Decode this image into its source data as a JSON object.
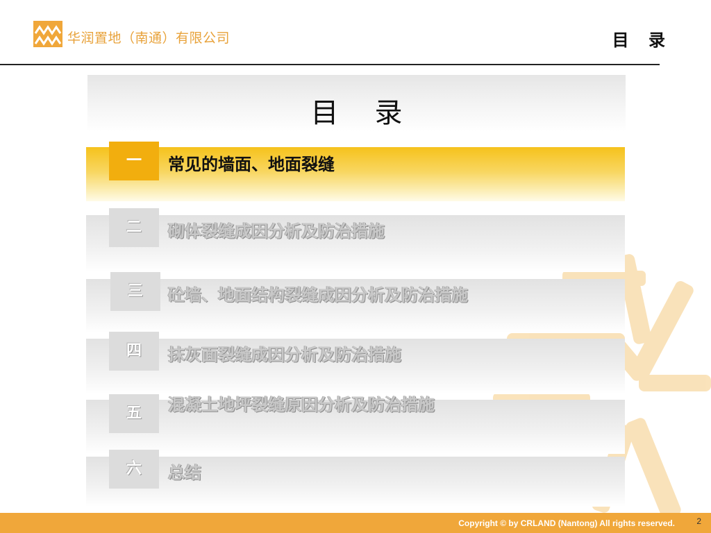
{
  "header": {
    "company_name": "华润置地（南通）有限公司",
    "title": "目 录"
  },
  "panel": {
    "title": "目录"
  },
  "toc": {
    "items": [
      {
        "num": "一",
        "label": "常见的墙面、地面裂缝",
        "active": true
      },
      {
        "num": "二",
        "label": "砌体裂缝成因分析及防治措施",
        "active": false
      },
      {
        "num": "三",
        "label": "砼墙、地面结构裂缝成因分析及防治措施",
        "active": false
      },
      {
        "num": "四",
        "label": "抹灰面裂缝成因分析及防治措施",
        "active": false
      },
      {
        "num": "五",
        "label": "混凝土地坪裂缝原因分析及防治措施",
        "active": false
      },
      {
        "num": "六",
        "label": "总结",
        "active": false
      }
    ]
  },
  "footer": {
    "copyright": "Copyright © by CRLAND (Nantong) All rights reserved.",
    "page_number": "2"
  },
  "colors": {
    "brand_orange": "#f0a73a",
    "active_yellow": "#f2ae0e",
    "logo_orange": "#e8a23a"
  },
  "icons": {
    "logo": "crland-mountain-logo-icon",
    "background": "sunburst-decoration-icon"
  }
}
